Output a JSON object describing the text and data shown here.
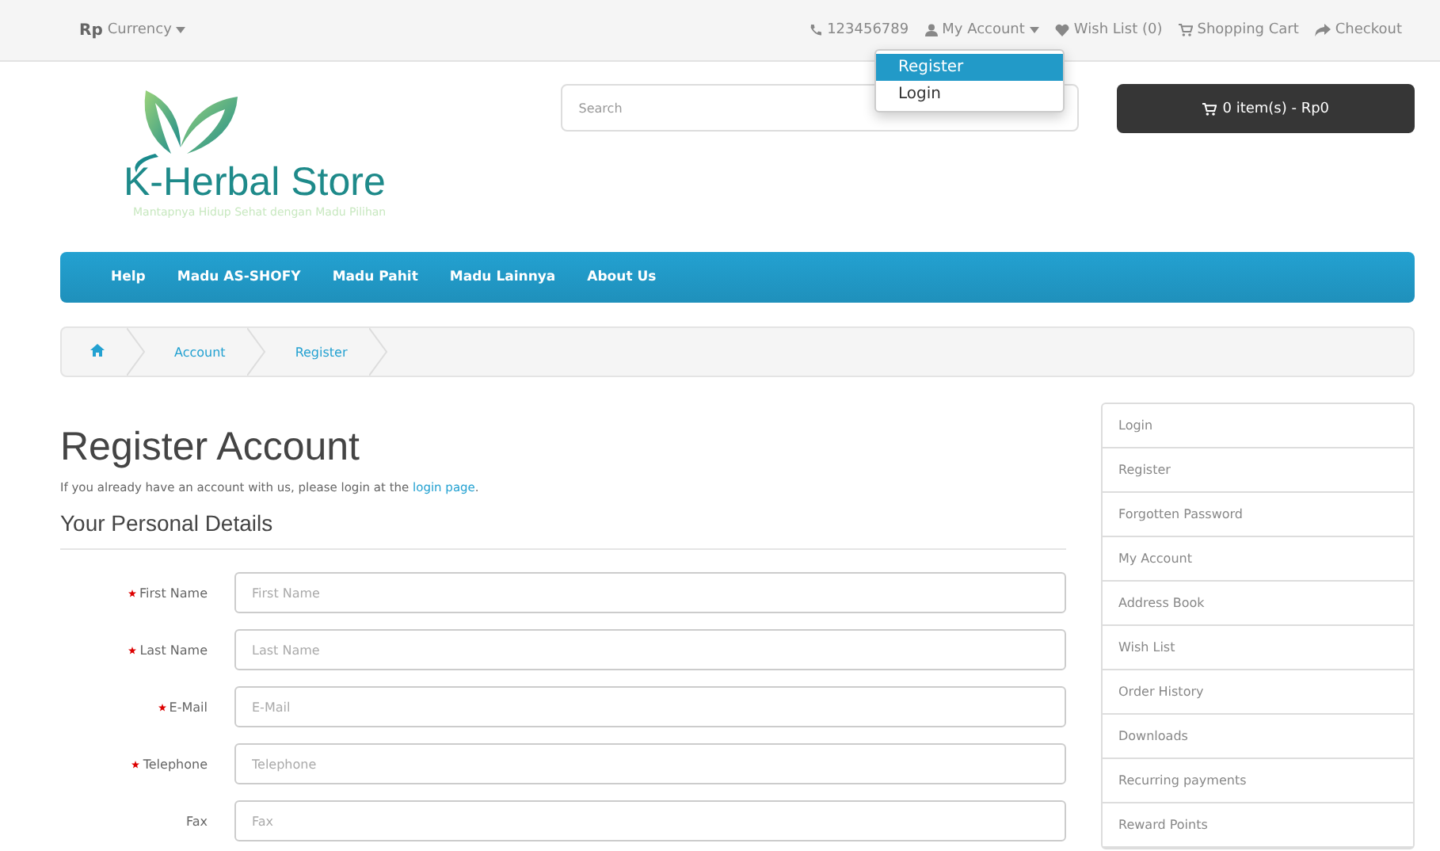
{
  "top_bar": {
    "currency_symbol": "Rp",
    "currency_label": "Currency",
    "phone": "123456789",
    "links": [
      {
        "label": "My Account",
        "kind": "dropdown"
      },
      {
        "label": "Wish List (0)",
        "kind": "heart"
      },
      {
        "label": "Shopping Cart",
        "kind": "cart"
      },
      {
        "label": "Checkout",
        "kind": "share"
      }
    ]
  },
  "account_menu": [
    {
      "label": "Register",
      "selected": true
    },
    {
      "label": "Login",
      "selected": false
    }
  ],
  "logo": {
    "name": "K-Herbal Store",
    "tagline": "Mantapnya Hidup Sehat dengan Madu Pilihan"
  },
  "search": {
    "placeholder": "Search"
  },
  "cart_button": "0 item(s) - Rp0",
  "nav": [
    "Help",
    "Madu AS-SHOFY",
    "Madu Pahit",
    "Madu Lainnya",
    "About Us"
  ],
  "breadcrumb": [
    "Account",
    "Register"
  ],
  "page_title": "Register Account",
  "intro": {
    "text": "If you already have an account with us, please login at the ",
    "link": "login page",
    "end": "."
  },
  "section_title": "Your Personal Details",
  "fields": [
    {
      "label": "First Name",
      "placeholder": "First Name",
      "required": true
    },
    {
      "label": "Last Name",
      "placeholder": "Last Name",
      "required": true
    },
    {
      "label": "E-Mail",
      "placeholder": "E-Mail",
      "required": true
    },
    {
      "label": "Telephone",
      "placeholder": "Telephone",
      "required": true
    },
    {
      "label": "Fax",
      "placeholder": "Fax",
      "required": false
    }
  ],
  "sidebar": [
    "Login",
    "Register",
    "Forgotten Password",
    "My Account",
    "Address Book",
    "Wish List",
    "Order History",
    "Downloads",
    "Recurring payments",
    "Reward Points"
  ]
}
